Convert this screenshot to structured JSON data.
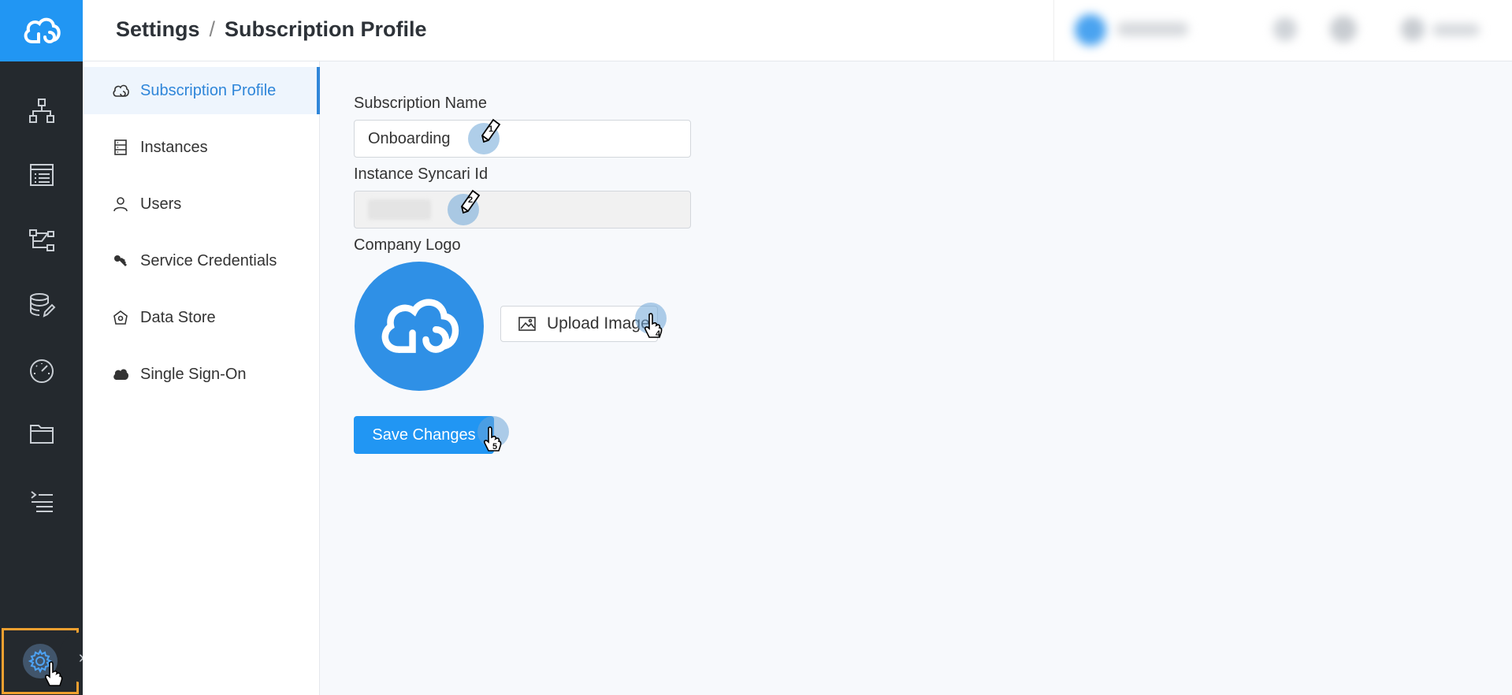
{
  "header": {
    "breadcrumb_root": "Settings",
    "breadcrumb_separator": "/",
    "breadcrumb_current": "Subscription Profile"
  },
  "rail": {
    "items": [
      "logo-icon",
      "topology-icon",
      "list-icon",
      "flow-icon",
      "database-edit-icon",
      "gauge-icon",
      "folder-icon",
      "log-list-icon",
      "gear-icon"
    ],
    "expand_label": "»"
  },
  "subnav": {
    "items": [
      {
        "label": "Subscription Profile",
        "icon": "cloud-sync-icon",
        "active": true
      },
      {
        "label": "Instances",
        "icon": "server-icon",
        "active": false
      },
      {
        "label": "Users",
        "icon": "user-icon",
        "active": false
      },
      {
        "label": "Service Credentials",
        "icon": "key-icon",
        "active": false
      },
      {
        "label": "Data Store",
        "icon": "data-store-icon",
        "active": false
      },
      {
        "label": "Single Sign-On",
        "icon": "cloud-icon",
        "active": false
      }
    ]
  },
  "form": {
    "subscription_name_label": "Subscription Name",
    "subscription_name_value": "Onboarding",
    "instance_id_label": "Instance Syncari Id",
    "company_logo_label": "Company Logo",
    "upload_label": "Upload Image",
    "save_label": "Save Changes"
  },
  "markers": [
    "1",
    "2",
    "4",
    "5"
  ],
  "colors": {
    "accent": "#2196f3",
    "rail_bg": "#24292e",
    "active_text": "#2f86d9",
    "highlight_border": "#f0a030"
  }
}
